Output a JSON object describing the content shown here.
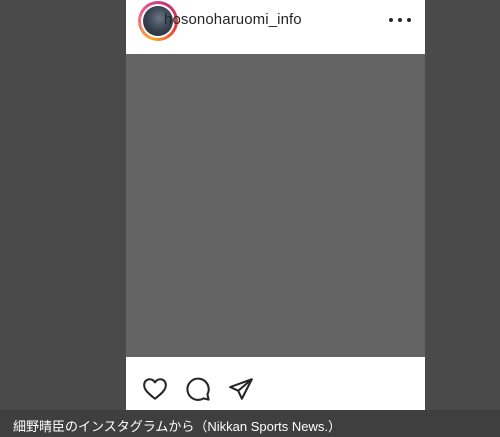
{
  "post": {
    "username": "hosonoharuomi_info",
    "more_icon": "more-horizontal-icon",
    "actions": {
      "like_icon": "heart-icon",
      "comment_icon": "comment-icon",
      "share_icon": "send-icon"
    }
  },
  "caption": {
    "text": "細野晴臣のインスタグラムから（Nikkan Sports News.）"
  },
  "colors": {
    "background": "#4a4a4a",
    "media_placeholder": "#646464",
    "caption_bar": "#3f3f3f",
    "text_dark": "#262626"
  }
}
